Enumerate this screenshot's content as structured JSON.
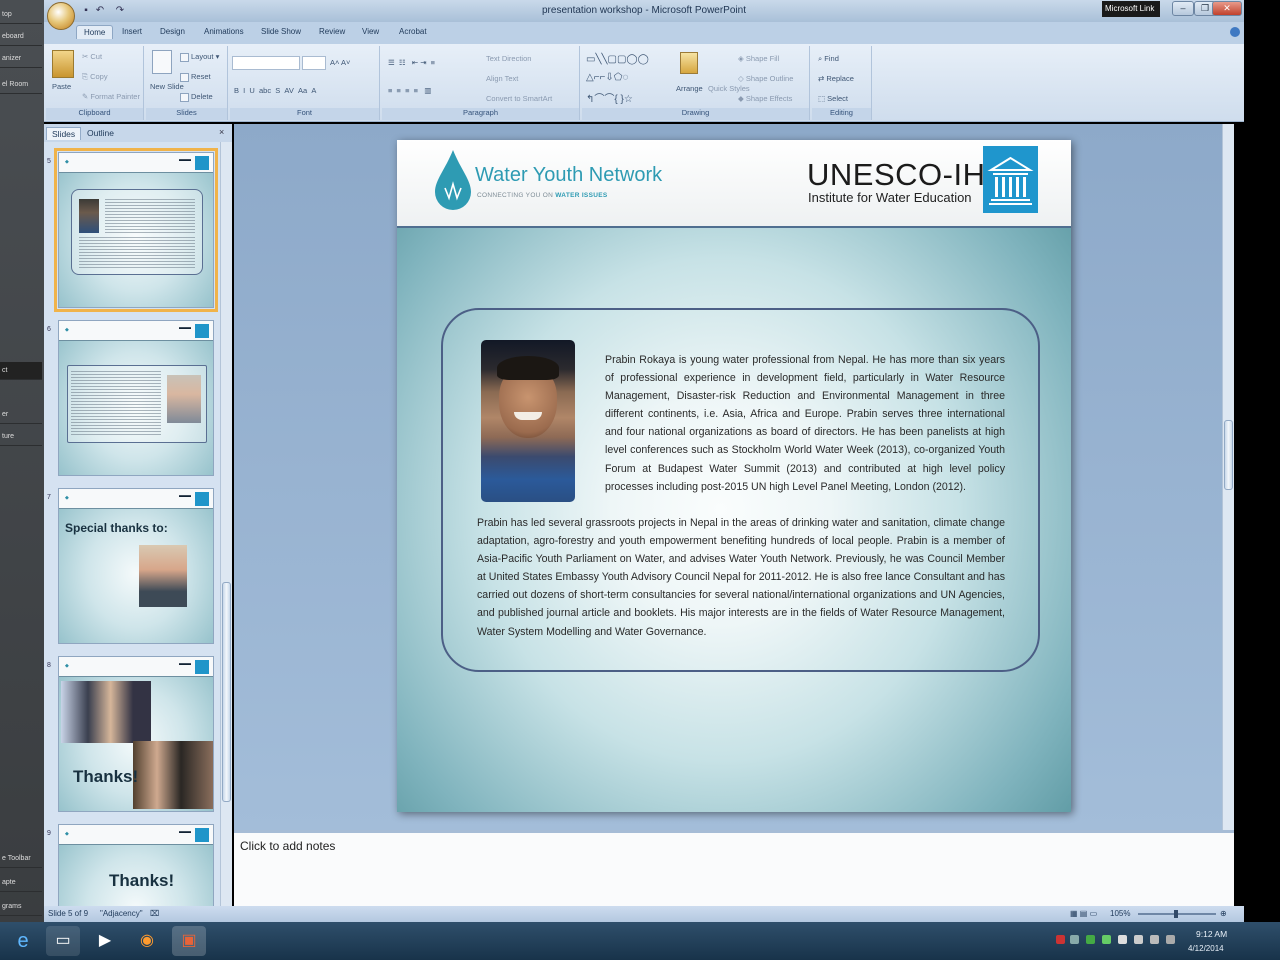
{
  "left_strip": {
    "items": [
      "top",
      "eboard",
      "anizer",
      "el Room",
      "ct",
      "er",
      "ture",
      "e Toolbar",
      "apte",
      "grams"
    ]
  },
  "window": {
    "title": "presentation workshop - Microsoft PowerPoint",
    "tooltip": "Microsoft Link"
  },
  "ribbon": {
    "tabs": [
      "Home",
      "Insert",
      "Design",
      "Animations",
      "Slide Show",
      "Review",
      "View",
      "Acrobat"
    ],
    "clipboard": {
      "paste": "Paste",
      "cut": "Cut",
      "copy": "Copy",
      "format_painter": "Format Painter",
      "label": "Clipboard"
    },
    "slides": {
      "new_slide": "New Slide",
      "layout": "Layout",
      "reset": "Reset",
      "delete": "Delete",
      "label": "Slides"
    },
    "font": {
      "label": "Font"
    },
    "paragraph": {
      "text_direction": "Text Direction",
      "align_text": "Align Text",
      "convert_smartart": "Convert to SmartArt",
      "label": "Paragraph"
    },
    "drawing": {
      "arrange": "Arrange",
      "quick_styles": "Quick Styles",
      "shape_fill": "Shape Fill",
      "shape_outline": "Shape Outline",
      "shape_effects": "Shape Effects",
      "label": "Drawing"
    },
    "editing": {
      "find": "Find",
      "replace": "Replace",
      "select": "Select",
      "label": "Editing"
    }
  },
  "panel": {
    "tabs": [
      "Slides",
      "Outline"
    ],
    "thumbs": [
      {
        "num": "5"
      },
      {
        "num": "6"
      },
      {
        "num": "7",
        "heading": "Special thanks to:"
      },
      {
        "num": "8",
        "heading": "Thanks!"
      },
      {
        "num": "9",
        "heading": "Thanks!"
      }
    ]
  },
  "slide": {
    "wyn_name": "Water Youth Network",
    "wyn_tagline_a": "CONNECTING YOU ON",
    "wyn_tagline_b": "WATER ISSUES",
    "unesco_name": "UNESCO-IHE",
    "unesco_sub": "Institute for Water Education",
    "bio_p1": "Prabin Rokaya is young water professional from Nepal. He has more than six years of professional experience in development field, particularly in Water Resource Management, Disaster-risk Reduction and Environmental Management in three different continents, i.e. Asia, Africa and Europe. Prabin serves three international and four national organizations as board of directors. He has been panelists at high level conferences such as Stockholm World Water Week (2013), co-organized Youth Forum at Budapest Water Summit (2013) and contributed at high level policy processes including post-2015 UN high Level Panel Meeting, London (2012).",
    "bio_p2": "Prabin has led several grassroots projects in Nepal in the areas of drinking water and sanitation, climate change adaptation, agro-forestry and youth empowerment benefiting hundreds of local people. Prabin is a member of Asia-Pacific Youth Parliament on Water, and advises Water Youth Network. Previously, he was Council Member at United States Embassy Youth Advisory Council Nepal for 2011-2012. He is also free lance Consultant and has carried out dozens of short-term consultancies for several national/international organizations and UN Agencies, and published journal article and booklets. His major interests are in the fields of Water Resource Management, Water System Modelling and Water Governance."
  },
  "notes": {
    "placeholder": "Click to add notes"
  },
  "status": {
    "slide": "Slide 5 of 9",
    "theme": "\"Adjacency\"",
    "zoom": "105%"
  },
  "clock": {
    "time": "9:12 AM",
    "date": "4/12/2014"
  }
}
